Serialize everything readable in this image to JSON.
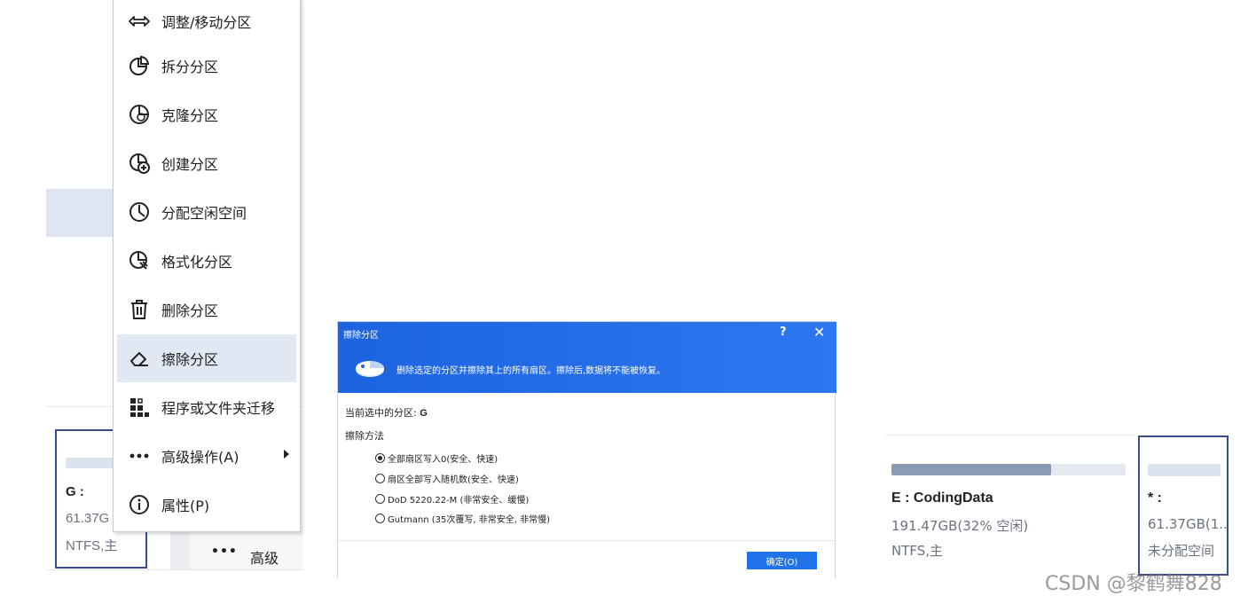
{
  "context_menu": {
    "items": [
      {
        "label": "调整/移动分区",
        "icon": "resize-move-icon"
      },
      {
        "label": "拆分分区",
        "icon": "split-partition-icon"
      },
      {
        "label": "克隆分区",
        "icon": "clone-partition-icon"
      },
      {
        "label": "创建分区",
        "icon": "create-partition-icon"
      },
      {
        "label": "分配空闲空间",
        "icon": "allocate-space-icon"
      },
      {
        "label": "格式化分区",
        "icon": "format-partition-icon"
      },
      {
        "label": "删除分区",
        "icon": "trash-icon"
      },
      {
        "label": "擦除分区",
        "icon": "eraser-icon",
        "highlighted": true
      },
      {
        "label": "程序或文件夹迁移",
        "icon": "app-migrate-icon"
      },
      {
        "label": "高级操作(A)",
        "icon": "more-dots-icon",
        "has_submenu": true
      },
      {
        "label": "属性(P)",
        "icon": "info-icon"
      }
    ]
  },
  "partition_g": {
    "name": "G :",
    "size": "61.37G",
    "fs": "NTFS,主"
  },
  "advanced_button": {
    "dots": "•••",
    "label": "高级"
  },
  "wipe_dialog": {
    "title": "擦除分区",
    "help": "?",
    "close": "✕",
    "description": "删除选定的分区并擦除其上的所有扇区。擦除后,数据将不能被恢复。",
    "current_label": "当前选中的分区:",
    "current_value": "G",
    "method_label": "擦除方法",
    "options": [
      {
        "label": "全部扇区写入0(安全、快速)",
        "selected": true
      },
      {
        "label": "扇区全部写入随机数(安全、快速)",
        "selected": false
      },
      {
        "label": "DoD 5220.22-M (非常安全、缓慢)",
        "selected": false
      },
      {
        "label": "Gutmann (35次覆写, 非常安全, 非常慢)",
        "selected": false
      }
    ],
    "ok_button": "确定(O)"
  },
  "partition_e": {
    "name": "E : CodingData",
    "size": "191.47GB(32% 空闲)",
    "fs": "NTFS,主",
    "used_fraction": 0.68
  },
  "partition_unalloc": {
    "name": "* :",
    "size": "61.37GB(1..",
    "fs": "未分配空间"
  },
  "watermark": "CSDN @黎鹤舞828",
  "colors": {
    "dialog_header": "#1d63e0",
    "card_border": "#3b4c8e",
    "ok_button": "#2173ea",
    "menu_highlight": "#e1e8f4"
  }
}
